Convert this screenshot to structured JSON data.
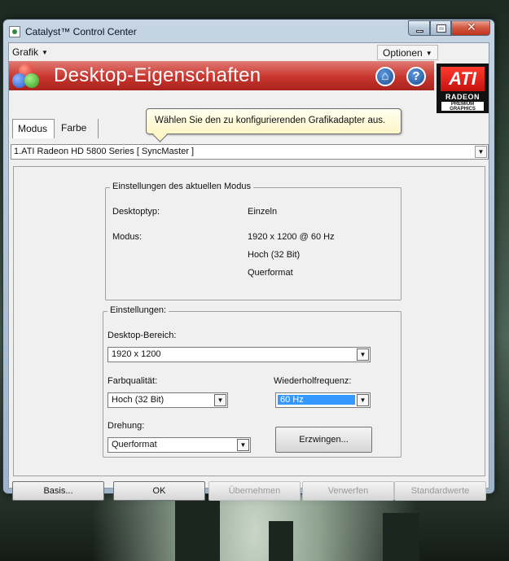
{
  "window": {
    "title": "Catalyst™ Control Center"
  },
  "menubar": {
    "grafik": "Grafik",
    "optionen": "Optionen"
  },
  "header": {
    "title": "Desktop-Eigenschaften",
    "home_icon": "home-icon",
    "help_icon": "help-icon"
  },
  "logo": {
    "ati": "ATI",
    "radeon": "RADEON",
    "premium": "PREMIUM GRAPHICS"
  },
  "tabs": [
    {
      "label": "Modus"
    },
    {
      "label": "Farbe"
    }
  ],
  "tooltip": {
    "text": "Wählen Sie den zu konfigurierenden Grafikadapter aus."
  },
  "adapter": {
    "selected": "1.ATI Radeon HD 5800 Series [ SyncMaster ]"
  },
  "current_mode": {
    "legend": "Einstellungen des aktuellen Modus",
    "desktop_type_label": "Desktoptyp:",
    "desktop_type_value": "Einzeln",
    "mode_label": "Modus:",
    "mode_values": [
      "1920 x 1200 @ 60 Hz",
      "Hoch (32 Bit)",
      "Querformat"
    ]
  },
  "settings": {
    "legend": "Einstellungen:",
    "desktop_area_label": "Desktop-Bereich:",
    "desktop_area_value": "1920 x 1200",
    "color_quality_label": "Farbqualität:",
    "color_quality_value": "Hoch (32 Bit)",
    "refresh_label": "Wiederholfrequenz:",
    "refresh_value": "60 Hz",
    "rotation_label": "Drehung:",
    "rotation_value": "Querformat",
    "force_button": "Erzwingen..."
  },
  "buttons": {
    "basis": "Basis...",
    "ok": "OK",
    "apply": "Übernehmen",
    "discard": "Verwerfen",
    "defaults": "Standardwerte"
  },
  "colors": {
    "header_red": "#c8352e",
    "selection_blue": "#3399ff"
  }
}
